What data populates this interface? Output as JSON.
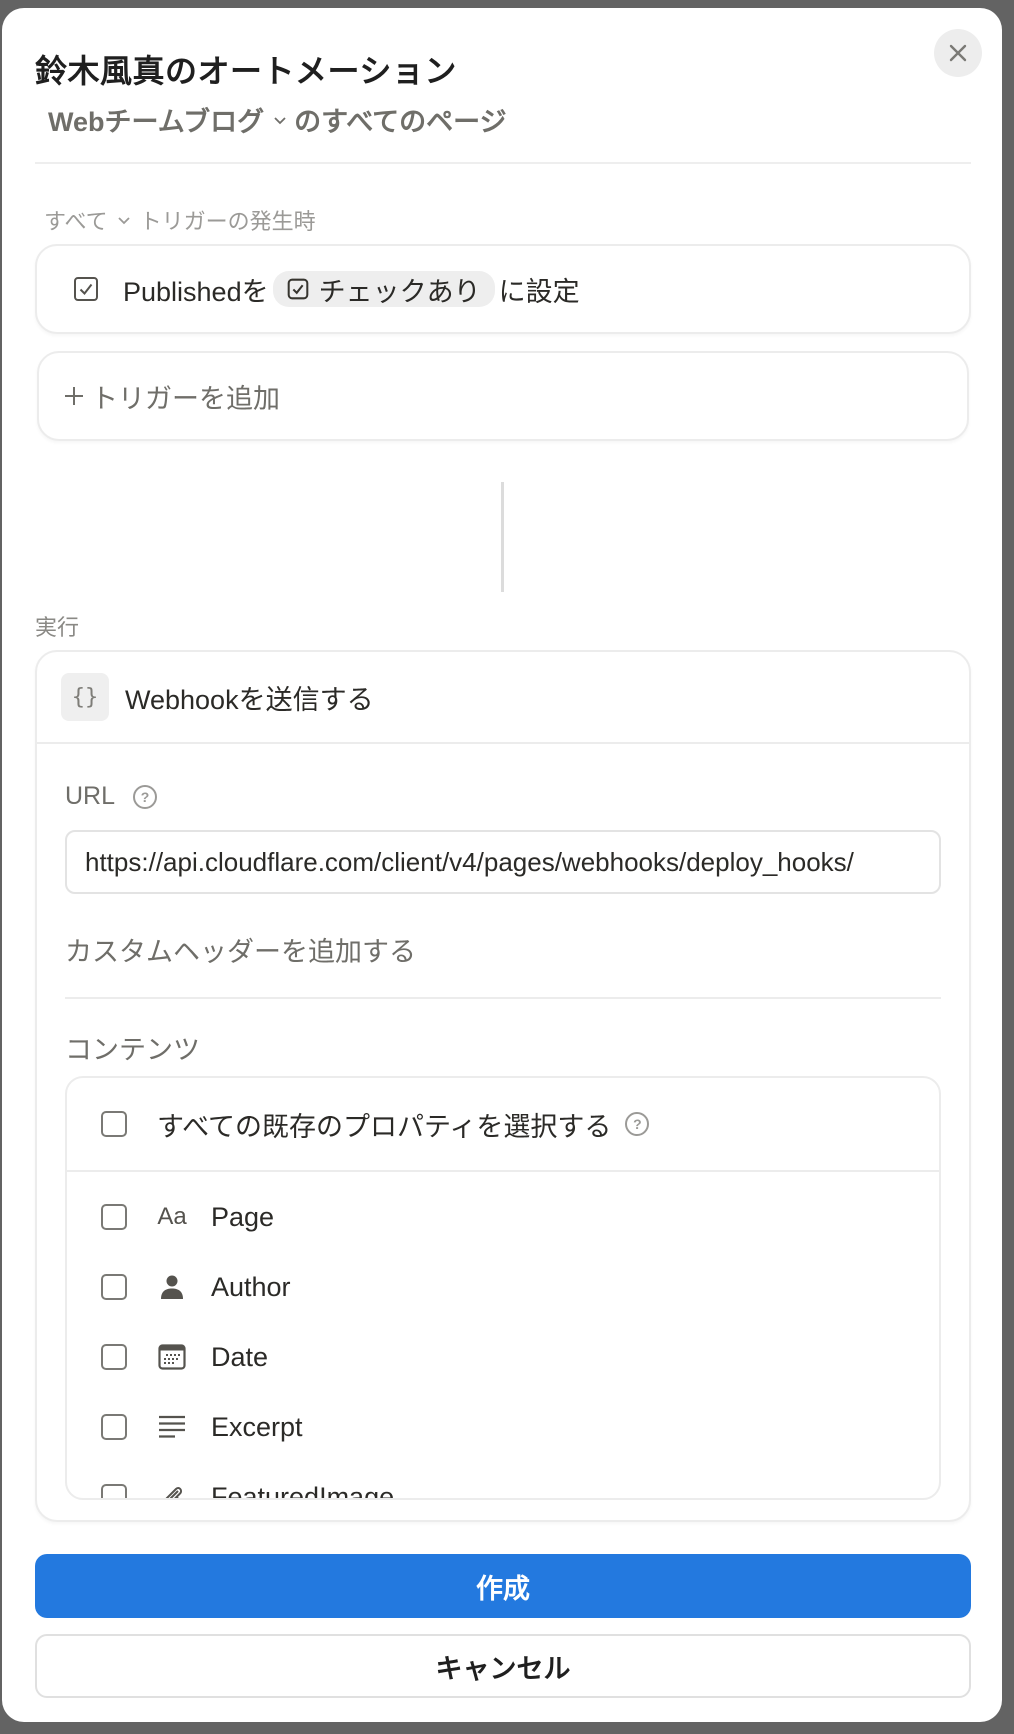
{
  "dialog": {
    "title": "鈴木風真のオートメーション",
    "close_icon": "close-icon",
    "subtitle": {
      "database": "Webチームブログ",
      "suffix": "のすべてのページ"
    }
  },
  "triggers": {
    "header_scope": "すべて",
    "header_text": "トリガーの発生時",
    "items": [
      {
        "property": "Publishedを",
        "value": "チェックあり",
        "suffix": "に設定",
        "icon": "checkbox-checked-icon"
      }
    ],
    "add_label": "トリガーを追加"
  },
  "actions": {
    "section_label": "実行",
    "webhook": {
      "icon": "code-braces-icon",
      "icon_glyph": "{}",
      "title": "Webhookを送信する",
      "url_label": "URL",
      "url_value": "https://api.cloudflare.com/client/v4/pages/webhooks/deploy_hooks/",
      "custom_header_label": "カスタムヘッダーを追加する",
      "content_label": "コンテンツ",
      "select_all_label": "すべての既存のプロパティを選択する",
      "select_all_checked": false,
      "properties": [
        {
          "name": "Page",
          "icon": "title-icon",
          "glyph": "Aa",
          "checked": false
        },
        {
          "name": "Author",
          "icon": "person-icon",
          "glyph": "",
          "checked": false
        },
        {
          "name": "Date",
          "icon": "calendar-icon",
          "glyph": "",
          "checked": false
        },
        {
          "name": "Excerpt",
          "icon": "text-lines-icon",
          "glyph": "",
          "checked": false
        },
        {
          "name": "FeaturedImage",
          "icon": "paperclip-icon",
          "glyph": "",
          "checked": false
        }
      ]
    }
  },
  "footer": {
    "create_label": "作成",
    "cancel_label": "キャンセル"
  },
  "colors": {
    "primary": "#2379df",
    "overlay": "#636363"
  }
}
